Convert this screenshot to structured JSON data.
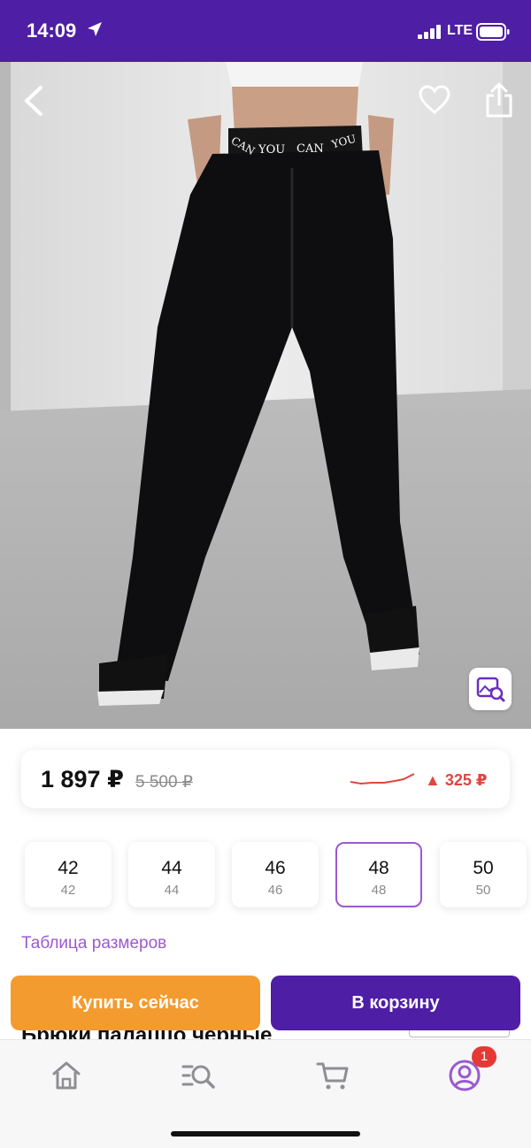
{
  "status_bar": {
    "time": "14:09",
    "network": "LTE"
  },
  "product_image": {
    "waistband_text": [
      "CAN",
      "YOU",
      "CAN",
      "YOU"
    ]
  },
  "price": {
    "current": "1 897 ₽",
    "old": "5 500 ₽",
    "change": "325 ₽",
    "trend_color": "#e0453f"
  },
  "sizes": [
    {
      "main": "42",
      "sub": "42",
      "selected": false
    },
    {
      "main": "44",
      "sub": "44",
      "selected": false
    },
    {
      "main": "46",
      "sub": "46",
      "selected": false
    },
    {
      "main": "48",
      "sub": "48",
      "selected": true
    },
    {
      "main": "50",
      "sub": "50",
      "selected": false
    }
  ],
  "size_table_link": "Таблица размеров",
  "actions": {
    "buy_now": "Купить сейчас",
    "add_to_cart": "В корзину"
  },
  "product_title": "Брюки палаццо черные",
  "tab_bar": {
    "items": [
      "home-icon",
      "catalog-search-icon",
      "cart-icon",
      "profile-icon"
    ],
    "active": "profile-icon",
    "profile_badge": "1"
  },
  "colors": {
    "brand": "#4e1ea4",
    "accent_orange": "#f39b2f",
    "link_purple": "#9b59d0"
  }
}
